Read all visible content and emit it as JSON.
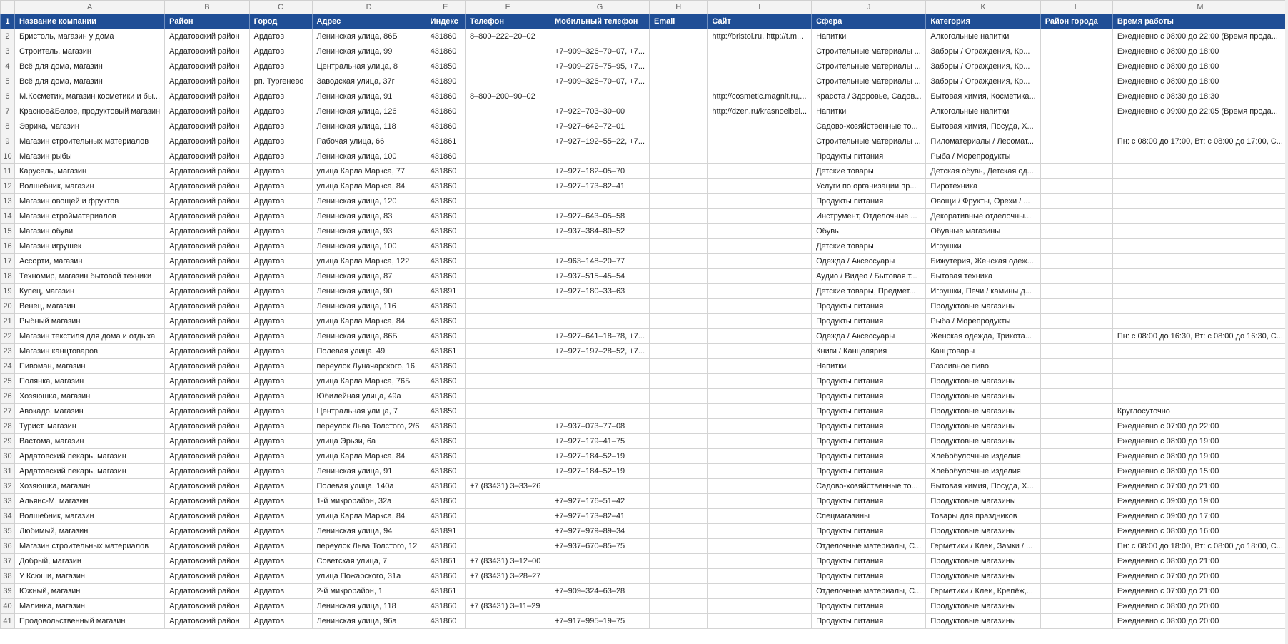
{
  "columns": [
    "A",
    "B",
    "C",
    "D",
    "E",
    "F",
    "G",
    "H",
    "I",
    "J",
    "K",
    "L",
    "M"
  ],
  "headers": [
    "Название компании",
    "Район",
    "Город",
    "Адрес",
    "Индекс",
    "Телефон",
    "Мобильный телефон",
    "Email",
    "Сайт",
    "Сфера",
    "Категория",
    "Район города",
    "Время работы"
  ],
  "rows": [
    [
      "Бристоль, магазин у дома",
      "Ардатовский район",
      "Ардатов",
      "Ленинская улица, 86Б",
      "431860",
      "8–800–222–20–02",
      "",
      "",
      "http://bristol.ru, http://t.m...",
      "Напитки",
      "Алкогольные напитки",
      "",
      "Ежедневно с 08:00 до 22:00 (Время прода..."
    ],
    [
      "Строитель, магазин",
      "Ардатовский район",
      "Ардатов",
      "Ленинская улица, 99",
      "431860",
      "",
      "+7–909–326–70–07, +7...",
      "",
      "",
      "Строительные материалы ...",
      "Заборы / Ограждения, Кр...",
      "",
      "Ежедневно с 08:00 до 18:00"
    ],
    [
      "Всё для дома, магазин",
      "Ардатовский район",
      "Ардатов",
      "Центральная улица, 8",
      "431850",
      "",
      "+7–909–276–75–95, +7...",
      "",
      "",
      "Строительные материалы ...",
      "Заборы / Ограждения, Кр...",
      "",
      "Ежедневно с 08:00 до 18:00"
    ],
    [
      "Всё для дома, магазин",
      "Ардатовский район",
      "рп. Тургенево",
      "Заводская улица, 37г",
      "431890",
      "",
      "+7–909–326–70–07, +7...",
      "",
      "",
      "Строительные материалы ...",
      "Заборы / Ограждения, Кр...",
      "",
      "Ежедневно с 08:00 до 18:00"
    ],
    [
      "М.Косметик, магазин косметики и бы...",
      "Ардатовский район",
      "Ардатов",
      "Ленинская улица, 91",
      "431860",
      "8–800–200–90–02",
      "",
      "",
      "http://cosmetic.magnit.ru,...",
      "Красота / Здоровье, Садов...",
      "Бытовая химия, Косметика...",
      "",
      "Ежедневно с 08:30 до 18:30"
    ],
    [
      "Красное&Белое, продуктовый магазин",
      "Ардатовский район",
      "Ардатов",
      "Ленинская улица, 126",
      "431860",
      "",
      "+7–922–703–30–00",
      "",
      "http://dzen.ru/krasnoeibel...",
      "Напитки",
      "Алкогольные напитки",
      "",
      "Ежедневно с 09:00 до 22:05 (Время прода..."
    ],
    [
      "Эврика, магазин",
      "Ардатовский район",
      "Ардатов",
      "Ленинская улица, 118",
      "431860",
      "",
      "+7–927–642–72–01",
      "",
      "",
      "Садово-хозяйственные то...",
      "Бытовая химия, Посуда, Х...",
      "",
      ""
    ],
    [
      "Магазин строительных материалов",
      "Ардатовский район",
      "Ардатов",
      "Рабочая улица, 66",
      "431861",
      "",
      "+7–927–192–55–22, +7...",
      "",
      "",
      "Строительные материалы ...",
      "Пиломатериалы / Лесомат...",
      "",
      "Пн: с 08:00 до 17:00, Вт: с 08:00 до 17:00, С..."
    ],
    [
      "Магазин рыбы",
      "Ардатовский район",
      "Ардатов",
      "Ленинская улица, 100",
      "431860",
      "",
      "",
      "",
      "",
      "Продукты питания",
      "Рыба / Морепродукты",
      "",
      ""
    ],
    [
      "Карусель, магазин",
      "Ардатовский район",
      "Ардатов",
      "улица Карла Маркса, 77",
      "431860",
      "",
      "+7–927–182–05–70",
      "",
      "",
      "Детские товары",
      "Детская обувь, Детская од...",
      "",
      ""
    ],
    [
      "Волшебник, магазин",
      "Ардатовский район",
      "Ардатов",
      "улица Карла Маркса, 84",
      "431860",
      "",
      "+7–927–173–82–41",
      "",
      "",
      "Услуги по организации пр...",
      "Пиротехника",
      "",
      ""
    ],
    [
      "Магазин овощей и фруктов",
      "Ардатовский район",
      "Ардатов",
      "Ленинская улица, 120",
      "431860",
      "",
      "",
      "",
      "",
      "Продукты питания",
      "Овощи / Фрукты, Орехи / ...",
      "",
      ""
    ],
    [
      "Магазин стройматериалов",
      "Ардатовский район",
      "Ардатов",
      "Ленинская улица, 83",
      "431860",
      "",
      "+7–927–643–05–58",
      "",
      "",
      "Инструмент, Отделочные ...",
      "Декоративные отделочны...",
      "",
      ""
    ],
    [
      "Магазин обуви",
      "Ардатовский район",
      "Ардатов",
      "Ленинская улица, 93",
      "431860",
      "",
      "+7–937–384–80–52",
      "",
      "",
      "Обувь",
      "Обувные магазины",
      "",
      ""
    ],
    [
      "Магазин игрушек",
      "Ардатовский район",
      "Ардатов",
      "Ленинская улица, 100",
      "431860",
      "",
      "",
      "",
      "",
      "Детские товары",
      "Игрушки",
      "",
      ""
    ],
    [
      "Ассорти, магазин",
      "Ардатовский район",
      "Ардатов",
      "улица Карла Маркса, 122",
      "431860",
      "",
      "+7–963–148–20–77",
      "",
      "",
      "Одежда / Аксессуары",
      "Бижутерия, Женская одеж...",
      "",
      ""
    ],
    [
      "Техномир, магазин бытовой техники",
      "Ардатовский район",
      "Ардатов",
      "Ленинская улица, 87",
      "431860",
      "",
      "+7–937–515–45–54",
      "",
      "",
      "Аудио / Видео / Бытовая т...",
      "Бытовая техника",
      "",
      ""
    ],
    [
      "Купец, магазин",
      "Ардатовский район",
      "Ардатов",
      "Ленинская улица, 90",
      "431891",
      "",
      "+7–927–180–33–63",
      "",
      "",
      "Детские товары, Предмет...",
      "Игрушки, Печи / камины д...",
      "",
      ""
    ],
    [
      "Венец, магазин",
      "Ардатовский район",
      "Ардатов",
      "Ленинская улица, 116",
      "431860",
      "",
      "",
      "",
      "",
      "Продукты питания",
      "Продуктовые магазины",
      "",
      ""
    ],
    [
      "Рыбный магазин",
      "Ардатовский район",
      "Ардатов",
      "улица Карла Маркса, 84",
      "431860",
      "",
      "",
      "",
      "",
      "Продукты питания",
      "Рыба / Морепродукты",
      "",
      ""
    ],
    [
      "Магазин текстиля для дома и отдыха",
      "Ардатовский район",
      "Ардатов",
      "Ленинская улица, 86Б",
      "431860",
      "",
      "+7–927–641–18–78, +7...",
      "",
      "",
      "Одежда / Аксессуары",
      "Женская одежда, Трикота...",
      "",
      "Пн: с 08:00 до 16:30, Вт: с 08:00 до 16:30, С..."
    ],
    [
      "Магазин канцтоваров",
      "Ардатовский район",
      "Ардатов",
      "Полевая улица, 49",
      "431861",
      "",
      "+7–927–197–28–52, +7...",
      "",
      "",
      "Книги / Канцелярия",
      "Канцтовары",
      "",
      ""
    ],
    [
      "Пивоман, магазин",
      "Ардатовский район",
      "Ардатов",
      "переулок Луначарского, 16",
      "431860",
      "",
      "",
      "",
      "",
      "Напитки",
      "Разливное пиво",
      "",
      ""
    ],
    [
      "Полянка, магазин",
      "Ардатовский район",
      "Ардатов",
      "улица Карла Маркса, 76Б",
      "431860",
      "",
      "",
      "",
      "",
      "Продукты питания",
      "Продуктовые магазины",
      "",
      ""
    ],
    [
      "Хозяюшка, магазин",
      "Ардатовский район",
      "Ардатов",
      "Юбилейная улица, 49а",
      "431860",
      "",
      "",
      "",
      "",
      "Продукты питания",
      "Продуктовые магазины",
      "",
      ""
    ],
    [
      "Авокадо, магазин",
      "Ардатовский район",
      "Ардатов",
      "Центральная улица, 7",
      "431850",
      "",
      "",
      "",
      "",
      "Продукты питания",
      "Продуктовые магазины",
      "",
      "Круглосуточно"
    ],
    [
      "Турист, магазин",
      "Ардатовский район",
      "Ардатов",
      "переулок Льва Толстого, 2/6",
      "431860",
      "",
      "+7–937–073–77–08",
      "",
      "",
      "Продукты питания",
      "Продуктовые магазины",
      "",
      "Ежедневно с 07:00 до 22:00"
    ],
    [
      "Вастома, магазин",
      "Ардатовский район",
      "Ардатов",
      "улица Эрьзи, 6а",
      "431860",
      "",
      "+7–927–179–41–75",
      "",
      "",
      "Продукты питания",
      "Продуктовые магазины",
      "",
      "Ежедневно с 08:00 до 19:00"
    ],
    [
      "Ардатовский пекарь, магазин",
      "Ардатовский район",
      "Ардатов",
      "улица Карла Маркса, 84",
      "431860",
      "",
      "+7–927–184–52–19",
      "",
      "",
      "Продукты питания",
      "Хлебобулочные изделия",
      "",
      "Ежедневно с 08:00 до 19:00"
    ],
    [
      "Ардатовский пекарь, магазин",
      "Ардатовский район",
      "Ардатов",
      "Ленинская улица, 91",
      "431860",
      "",
      "+7–927–184–52–19",
      "",
      "",
      "Продукты питания",
      "Хлебобулочные изделия",
      "",
      "Ежедневно с 08:00 до 15:00"
    ],
    [
      "Хозяюшка, магазин",
      "Ардатовский район",
      "Ардатов",
      "Полевая улица, 140а",
      "431860",
      "+7 (83431) 3–33–26",
      "",
      "",
      "",
      "Садово-хозяйственные то...",
      "Бытовая химия, Посуда, Х...",
      "",
      "Ежедневно с 07:00 до 21:00"
    ],
    [
      "Альянс-М, магазин",
      "Ардатовский район",
      "Ардатов",
      "1-й микрорайон, 32а",
      "431860",
      "",
      "+7–927–176–51–42",
      "",
      "",
      "Продукты питания",
      "Продуктовые магазины",
      "",
      "Ежедневно с 09:00 до 19:00"
    ],
    [
      "Волшебник, магазин",
      "Ардатовский район",
      "Ардатов",
      "улица Карла Маркса, 84",
      "431860",
      "",
      "+7–927–173–82–41",
      "",
      "",
      "Спецмагазины",
      "Товары для праздников",
      "",
      "Ежедневно с 09:00 до 17:00"
    ],
    [
      "Любимый, магазин",
      "Ардатовский район",
      "Ардатов",
      "Ленинская улица, 94",
      "431891",
      "",
      "+7–927–979–89–34",
      "",
      "",
      "Продукты питания",
      "Продуктовые магазины",
      "",
      "Ежедневно с 08:00 до 16:00"
    ],
    [
      "Магазин строительных материалов",
      "Ардатовский район",
      "Ардатов",
      "переулок Льва Толстого, 12",
      "431860",
      "",
      "+7–937–670–85–75",
      "",
      "",
      "Отделочные материалы, С...",
      "Герметики / Клеи, Замки / ...",
      "",
      "Пн: с 08:00 до 18:00, Вт: с 08:00 до 18:00, С..."
    ],
    [
      "Добрый, магазин",
      "Ардатовский район",
      "Ардатов",
      "Советская улица, 7",
      "431861",
      "+7 (83431) 3–12–00",
      "",
      "",
      "",
      "Продукты питания",
      "Продуктовые магазины",
      "",
      "Ежедневно с 08:00 до 21:00"
    ],
    [
      "У Ксюши, магазин",
      "Ардатовский район",
      "Ардатов",
      "улица Пожарского, 31а",
      "431860",
      "+7 (83431) 3–28–27",
      "",
      "",
      "",
      "Продукты питания",
      "Продуктовые магазины",
      "",
      "Ежедневно с 07:00 до 20:00"
    ],
    [
      "Южный, магазин",
      "Ардатовский район",
      "Ардатов",
      "2-й микрорайон, 1",
      "431861",
      "",
      "+7–909–324–63–28",
      "",
      "",
      "Отделочные материалы, С...",
      "Герметики / Клеи, Крепёж,...",
      "",
      "Ежедневно с 07:00 до 21:00"
    ],
    [
      "Малинка, магазин",
      "Ардатовский район",
      "Ардатов",
      "Ленинская улица, 118",
      "431860",
      "+7 (83431) 3–11–29",
      "",
      "",
      "",
      "Продукты питания",
      "Продуктовые магазины",
      "",
      "Ежедневно с 08:00 до 20:00"
    ],
    [
      "Продовольственный магазин",
      "Ардатовский район",
      "Ардатов",
      "Ленинская улица, 96а",
      "431860",
      "",
      "+7–917–995–19–75",
      "",
      "",
      "Продукты питания",
      "Продуктовые магазины",
      "",
      "Ежедневно с 08:00 до 20:00"
    ]
  ]
}
